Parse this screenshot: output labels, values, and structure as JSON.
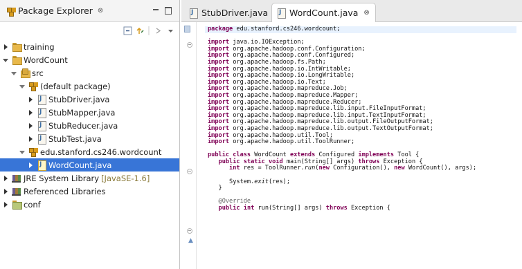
{
  "explorer": {
    "title": "Package Explorer",
    "close_glyph": "⊗",
    "tree": [
      {
        "label": "training",
        "level": 0,
        "state": "closed",
        "icon": "project-icon"
      },
      {
        "label": "WordCount",
        "level": 0,
        "state": "open",
        "icon": "project-icon"
      },
      {
        "label": "src",
        "level": 1,
        "state": "open",
        "icon": "source-folder-icon"
      },
      {
        "label": "(default package)",
        "level": 2,
        "state": "open",
        "icon": "package-icon"
      },
      {
        "label": "StubDriver.java",
        "level": 3,
        "state": "closed",
        "icon": "java-file-icon"
      },
      {
        "label": "StubMapper.java",
        "level": 3,
        "state": "closed",
        "icon": "java-file-icon"
      },
      {
        "label": "StubReducer.java",
        "level": 3,
        "state": "closed",
        "icon": "java-file-icon"
      },
      {
        "label": "StubTest.java",
        "level": 3,
        "state": "closed",
        "icon": "java-file-icon"
      },
      {
        "label": "edu.stanford.cs246.wordcount",
        "level": 2,
        "state": "open",
        "icon": "package-icon"
      },
      {
        "label": "WordCount.java",
        "level": 3,
        "state": "closed",
        "icon": "java-file-icon",
        "selected": true
      },
      {
        "label": "JRE System Library",
        "suffix": "[JavaSE-1.6]",
        "level": 0,
        "state": "closed",
        "icon": "library-icon"
      },
      {
        "label": "Referenced Libraries",
        "level": 0,
        "state": "closed",
        "icon": "library-icon"
      },
      {
        "label": "conf",
        "level": 0,
        "state": "closed",
        "icon": "folder-icon"
      }
    ]
  },
  "editor": {
    "tabs": [
      {
        "label": "StubDriver.java",
        "active": false
      },
      {
        "label": "WordCount.java",
        "active": true,
        "close_glyph": "⊗"
      }
    ],
    "code": [
      "package edu.stanford.cs246.wordcount;",
      "",
      "import java.io.IOException;",
      "import org.apache.hadoop.conf.Configuration;",
      "import org.apache.hadoop.conf.Configured;",
      "import org.apache.hadoop.fs.Path;",
      "import org.apache.hadoop.io.IntWritable;",
      "import org.apache.hadoop.io.LongWritable;",
      "import org.apache.hadoop.io.Text;",
      "import org.apache.hadoop.mapreduce.Job;",
      "import org.apache.hadoop.mapreduce.Mapper;",
      "import org.apache.hadoop.mapreduce.Reducer;",
      "import org.apache.hadoop.mapreduce.lib.input.FileInputFormat;",
      "import org.apache.hadoop.mapreduce.lib.input.TextInputFormat;",
      "import org.apache.hadoop.mapreduce.lib.output.FileOutputFormat;",
      "import org.apache.hadoop.mapreduce.lib.output.TextOutputFormat;",
      "import org.apache.hadoop.util.Tool;",
      "import org.apache.hadoop.util.ToolRunner;",
      "",
      "public class WordCount extends Configured implements Tool {",
      "   public static void main(String[] args) throws Exception {",
      "      int res = ToolRunner.run(new Configuration(), new WordCount(), args);",
      "",
      "      System.exit(res);",
      "   }",
      "",
      "   @Override",
      "   public int run(String[] args) throws Exception {"
    ]
  }
}
